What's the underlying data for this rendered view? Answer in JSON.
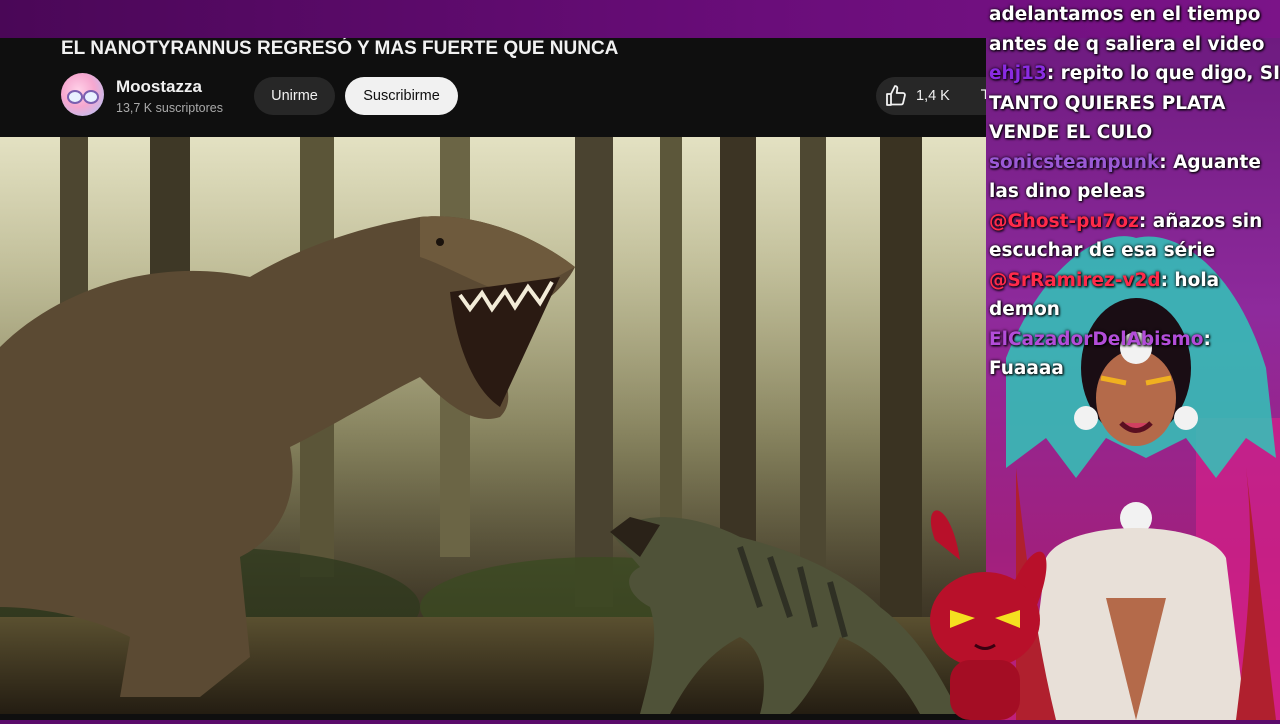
{
  "youtube": {
    "video_title": "EL NANOTYRANNUS REGRESÓ Y MAS FUERTE QUE NUNCA",
    "channel_name": "Moostazza",
    "subscribers": "13,7 K suscriptores",
    "join_label": "Unirme",
    "subscribe_label": "Suscribirme",
    "like_count": "1,4 K"
  },
  "chat": {
    "messages": [
      {
        "user": "",
        "user_color": "#ffffff",
        "text": "adelantamos en el tiempo antes de q saliera el video"
      },
      {
        "user": "ehj13",
        "user_color": "#8a2be2",
        "text": ": repito lo que digo, SI TANTO QUIERES PLATA VENDE EL CULO"
      },
      {
        "user": "sonicsteampunk",
        "user_color": "#9b59d6",
        "text": ": Aguante las dino peleas"
      },
      {
        "user": "@Ghost-pu7oz",
        "user_color": "#ff2a4a",
        "text": ": añazos sin escuchar de esa série"
      },
      {
        "user": "@SrRamirez-v2d",
        "user_color": "#ff2a4a",
        "text": ": hola demon"
      },
      {
        "user": "ElCazadorDelAbismo",
        "user_color": "#b34dd9",
        "text": ":"
      },
      {
        "user": "",
        "user_color": "#ffffff",
        "text": "Fuaaaa"
      }
    ]
  },
  "colors": {
    "overlay_purple": "#5a0b6b",
    "yt_background": "#0f0f0f",
    "yt_button": "#272727",
    "subscribe_button": "#f1f1f1"
  }
}
